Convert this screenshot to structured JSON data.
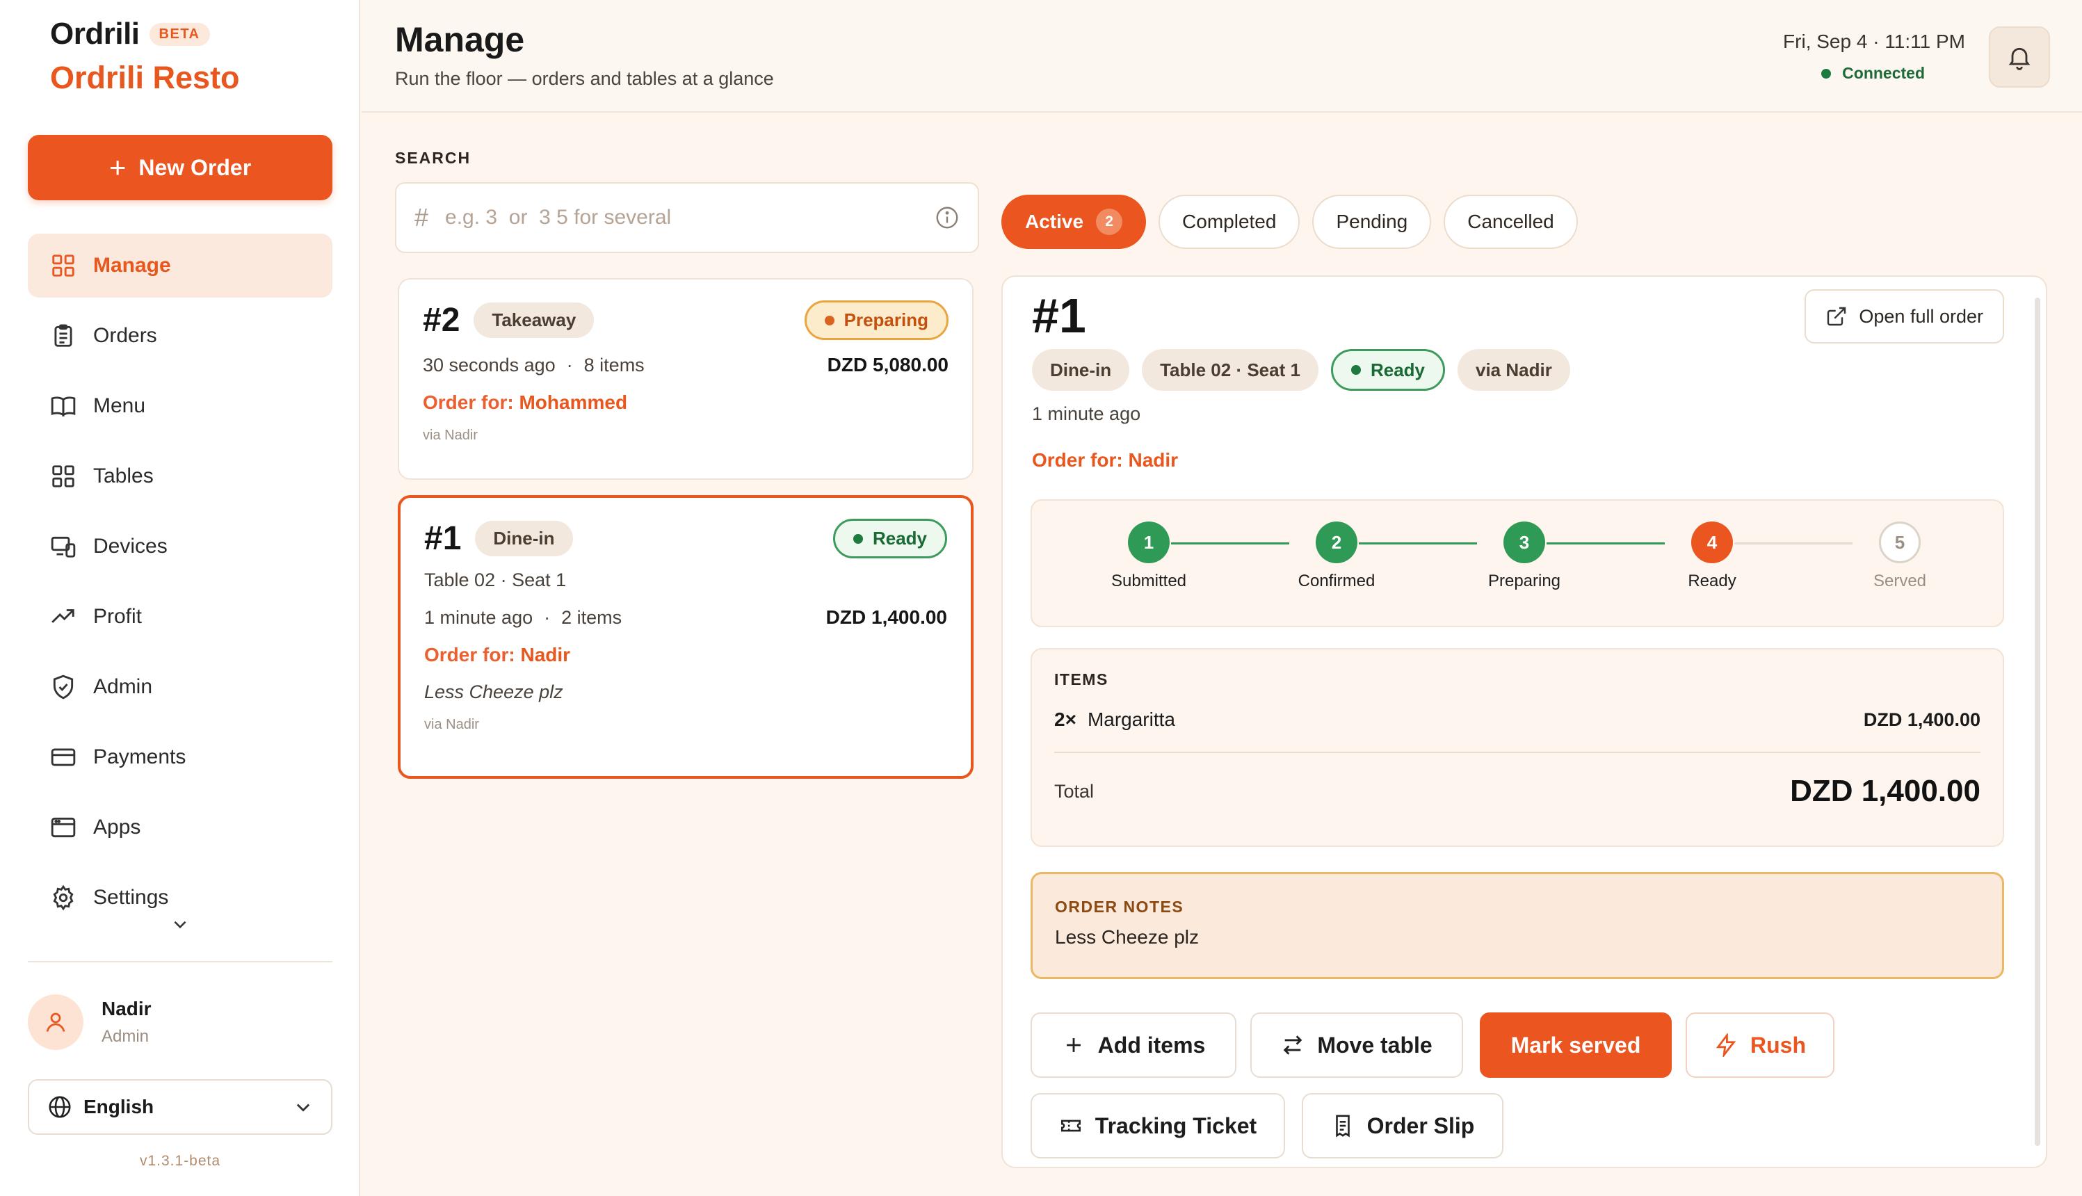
{
  "app": {
    "logo_text": "Ordrili",
    "beta": "BETA",
    "restaurant_name": "Ordrili Resto",
    "version": "v1.3.1-beta"
  },
  "sidebar": {
    "new_order_label": "New Order",
    "items": [
      {
        "label": "Manage",
        "icon": "grid-icon",
        "active": true
      },
      {
        "label": "Orders",
        "icon": "clipboard-icon"
      },
      {
        "label": "Menu",
        "icon": "book-icon"
      },
      {
        "label": "Tables",
        "icon": "tables-icon"
      },
      {
        "label": "Devices",
        "icon": "devices-icon"
      },
      {
        "label": "Profit",
        "icon": "trend-icon"
      },
      {
        "label": "Admin",
        "icon": "shield-icon"
      },
      {
        "label": "Payments",
        "icon": "card-icon"
      },
      {
        "label": "Apps",
        "icon": "window-icon"
      },
      {
        "label": "Settings",
        "icon": "gear-icon"
      }
    ],
    "user": {
      "name": "Nadir",
      "role": "Admin"
    },
    "language": "English"
  },
  "header": {
    "title": "Manage",
    "subtitle": "Run the floor — orders and tables at a glance",
    "datetime": "Fri, Sep 4 · 11:11 PM",
    "connection": "Connected"
  },
  "search": {
    "label": "SEARCH",
    "placeholder": "e.g. 3  or  3 5 for several"
  },
  "tabs": [
    {
      "label": "Active",
      "count": "2",
      "active": true
    },
    {
      "label": "Completed"
    },
    {
      "label": "Pending"
    },
    {
      "label": "Cancelled"
    }
  ],
  "orders": [
    {
      "number": "#2",
      "type": "Takeaway",
      "status": "Preparing",
      "time": "30 seconds ago",
      "items": "8 items",
      "amount": "DZD 5,080.00",
      "order_for_label": "Order for:",
      "customer": "Mohammed",
      "via": "via Nadir"
    },
    {
      "number": "#1",
      "type": "Dine-in",
      "status": "Ready",
      "table": "Table 02 · Seat 1",
      "time": "1 minute ago",
      "items": "2 items",
      "amount": "DZD 1,400.00",
      "order_for_label": "Order for:",
      "customer": "Nadir",
      "note": "Less Cheeze plz",
      "via": "via Nadir"
    }
  ],
  "detail": {
    "number": "#1",
    "open_full_label": "Open full order",
    "tags": {
      "service": "Dine-in",
      "table": "Table 02 · Seat 1",
      "status": "Ready",
      "via": "via Nadir"
    },
    "time": "1 minute ago",
    "order_for_label": "Order for:",
    "customer": "Nadir",
    "steps": [
      {
        "num": "1",
        "label": "Submitted",
        "state": "done"
      },
      {
        "num": "2",
        "label": "Confirmed",
        "state": "done"
      },
      {
        "num": "3",
        "label": "Preparing",
        "state": "done"
      },
      {
        "num": "4",
        "label": "Ready",
        "state": "current"
      },
      {
        "num": "5",
        "label": "Served",
        "state": "todo"
      }
    ],
    "items_label": "ITEMS",
    "items": [
      {
        "qty": "2×",
        "name": "Margaritta",
        "price": "DZD 1,400.00"
      }
    ],
    "total_label": "Total",
    "total": "DZD 1,400.00",
    "notes_label": "ORDER NOTES",
    "notes": "Less Cheeze plz",
    "actions": {
      "add_items": "Add items",
      "move_table": "Move table",
      "mark_served": "Mark served",
      "rush": "Rush",
      "tracking_ticket": "Tracking Ticket",
      "order_slip": "Order Slip"
    }
  },
  "colors": {
    "accent": "#ea5520",
    "success": "#2e9a55",
    "background": "#fdf5ee"
  }
}
